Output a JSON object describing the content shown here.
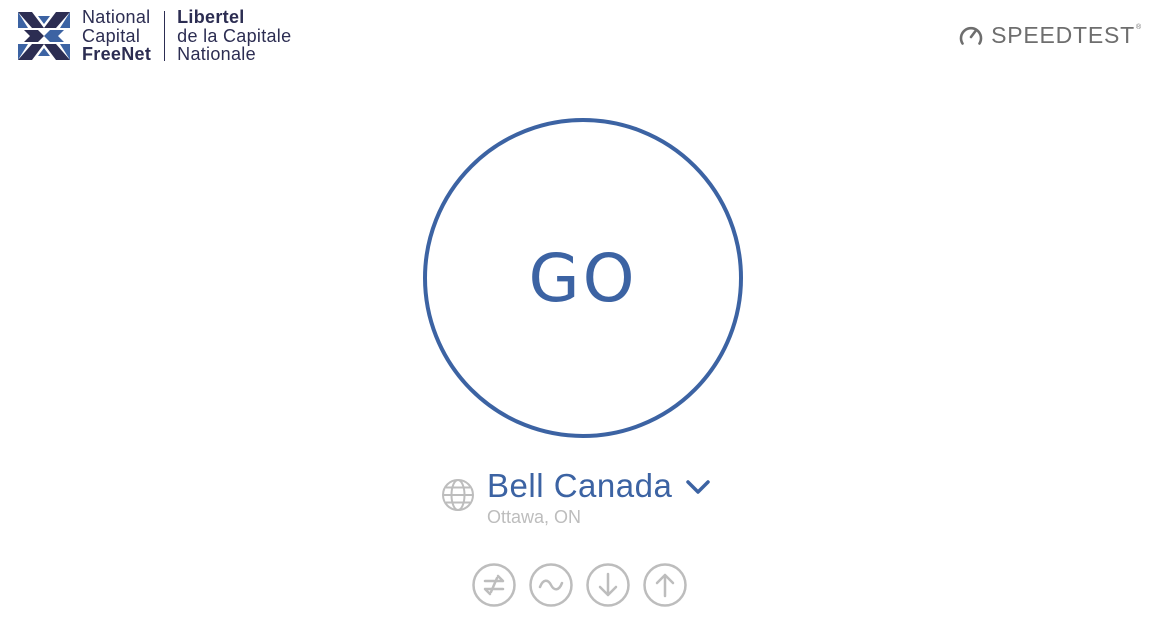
{
  "header": {
    "logo": {
      "left_line1": "National",
      "left_line2": "Capital",
      "left_line3": "FreeNet",
      "right_line1": "Libertel",
      "right_line2": "de la Capitale",
      "right_line3": "Nationale"
    },
    "brand": {
      "label": "SPEEDTEST",
      "trademark": "®",
      "icon": "speedometer-icon"
    }
  },
  "main": {
    "go_label": "GO",
    "server": {
      "name": "Bell Canada",
      "location": "Ottawa, ON",
      "icon": "globe-icon",
      "dropdown_icon": "chevron-down-icon"
    },
    "mode_icons": [
      "connections-icon",
      "wave-icon",
      "download-arrow-icon",
      "upload-arrow-icon"
    ]
  },
  "colors": {
    "accent": "#3c63a3",
    "logo_navy": "#2c2d52",
    "brand_grey": "#6e6e6e",
    "muted_grey": "#bdbdbd"
  }
}
